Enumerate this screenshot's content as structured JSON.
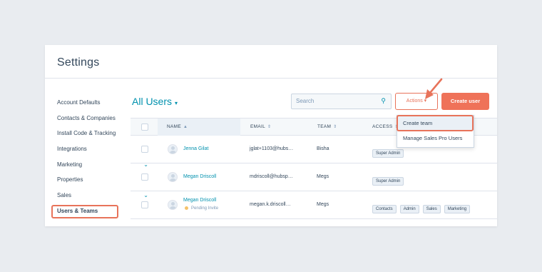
{
  "card": {
    "title": "Settings"
  },
  "sidebar": {
    "items": [
      {
        "label": "Account Defaults",
        "chevron": false
      },
      {
        "label": "Contacts & Companies",
        "chevron": false
      },
      {
        "label": "Install Code & Tracking",
        "chevron": false
      },
      {
        "label": "Integrations",
        "chevron": true
      },
      {
        "label": "Marketing",
        "chevron": true
      },
      {
        "label": "Properties",
        "chevron": false
      },
      {
        "label": "Sales",
        "chevron": true
      },
      {
        "label": "Users & Teams",
        "chevron": false,
        "active": true
      }
    ],
    "chevron_glyph": "⌄"
  },
  "main": {
    "title": "All Users",
    "title_caret": "▾",
    "search_placeholder": "Search",
    "search_icon": "⚲",
    "actions_label": "Actions ▾",
    "create_user_label": "Create user"
  },
  "table": {
    "columns": {
      "name": "NAME",
      "email": "EMAIL",
      "team": "TEAM",
      "access": "ACCESS"
    },
    "sort_asc": "▲",
    "sort_both": "⇕",
    "rows": [
      {
        "name": "Jenna Gilat",
        "email": "jglat+1103@hubs…",
        "team": "Bisha",
        "pending": "",
        "tags": [
          "Super Admin"
        ]
      },
      {
        "name": "Megan Driscoll",
        "email": "mdriscoll@hubsp…",
        "team": "Megs",
        "pending": "",
        "tags": [
          "Super Admin"
        ]
      },
      {
        "name": "Megan Driscoll",
        "email": "megan.k.driscoll…",
        "team": "Megs",
        "pending": "Pending Invite",
        "tags": [
          "Contacts",
          "Admin",
          "Sales",
          "Marketing"
        ]
      }
    ]
  },
  "dropdown": {
    "items": [
      "Create team",
      "Manage Sales Pro Users"
    ]
  },
  "colors": {
    "accent_orange": "#e8735a",
    "link_teal": "#0091ae",
    "text_dark": "#33475b",
    "background": "#e9ecf0"
  }
}
